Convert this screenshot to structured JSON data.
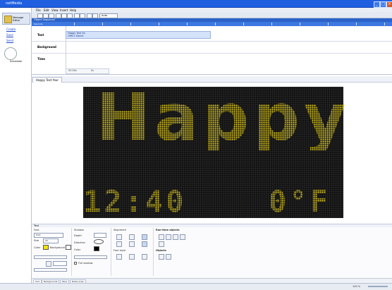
{
  "window": {
    "title": "netMedia",
    "controls": [
      "_",
      "□",
      "×"
    ]
  },
  "left_pane": {
    "message_button": "Message Editor",
    "links": [
      "Create",
      "Save",
      "Send"
    ],
    "scheduler_label": "Scheduler"
  },
  "menu": [
    "File",
    "Edit",
    "View",
    "Insert",
    "Help"
  ],
  "toolbar": {
    "zoom_value": "Auto"
  },
  "object_panel": {
    "header": "Object Sequence",
    "timeline_label": "Seconds",
    "rows": [
      {
        "label": "Text"
      },
      {
        "label": "Background"
      },
      {
        "label": "Time"
      }
    ],
    "track_items": [
      "Happy Text Fo",
      "OMC1 Zone1"
    ],
    "status": [
      "00:00s",
      "0s"
    ]
  },
  "document": {
    "tab": "Happy Text Your"
  },
  "led_display": {
    "main_text": "Happy",
    "clock": "12:40",
    "temperature": "0°F",
    "led_color": "#d8c317",
    "background": "#111111"
  },
  "text_panel": {
    "header": "Text",
    "font": {
      "section": "Font",
      "size_label": "Size",
      "color_label": "Color",
      "background_label": "Background",
      "font_value": "Font",
      "size_value": "12"
    },
    "shadow": {
      "section": "Shadow",
      "depth_label": "Depth",
      "direction_label": "Direction",
      "color_label": "Color",
      "full_shadow_label": "Full shadow"
    },
    "alignment": {
      "section": "Alignment",
      "font_style_label": "Font style"
    },
    "run_time": {
      "section": "Run-time objects"
    },
    "objects": {
      "section": "Objects"
    }
  },
  "bottom_tabs": [
    "Text",
    "Backgrounds",
    "Pane",
    "Notes Area"
  ],
  "status_bar": {
    "zoom": "100 %"
  }
}
